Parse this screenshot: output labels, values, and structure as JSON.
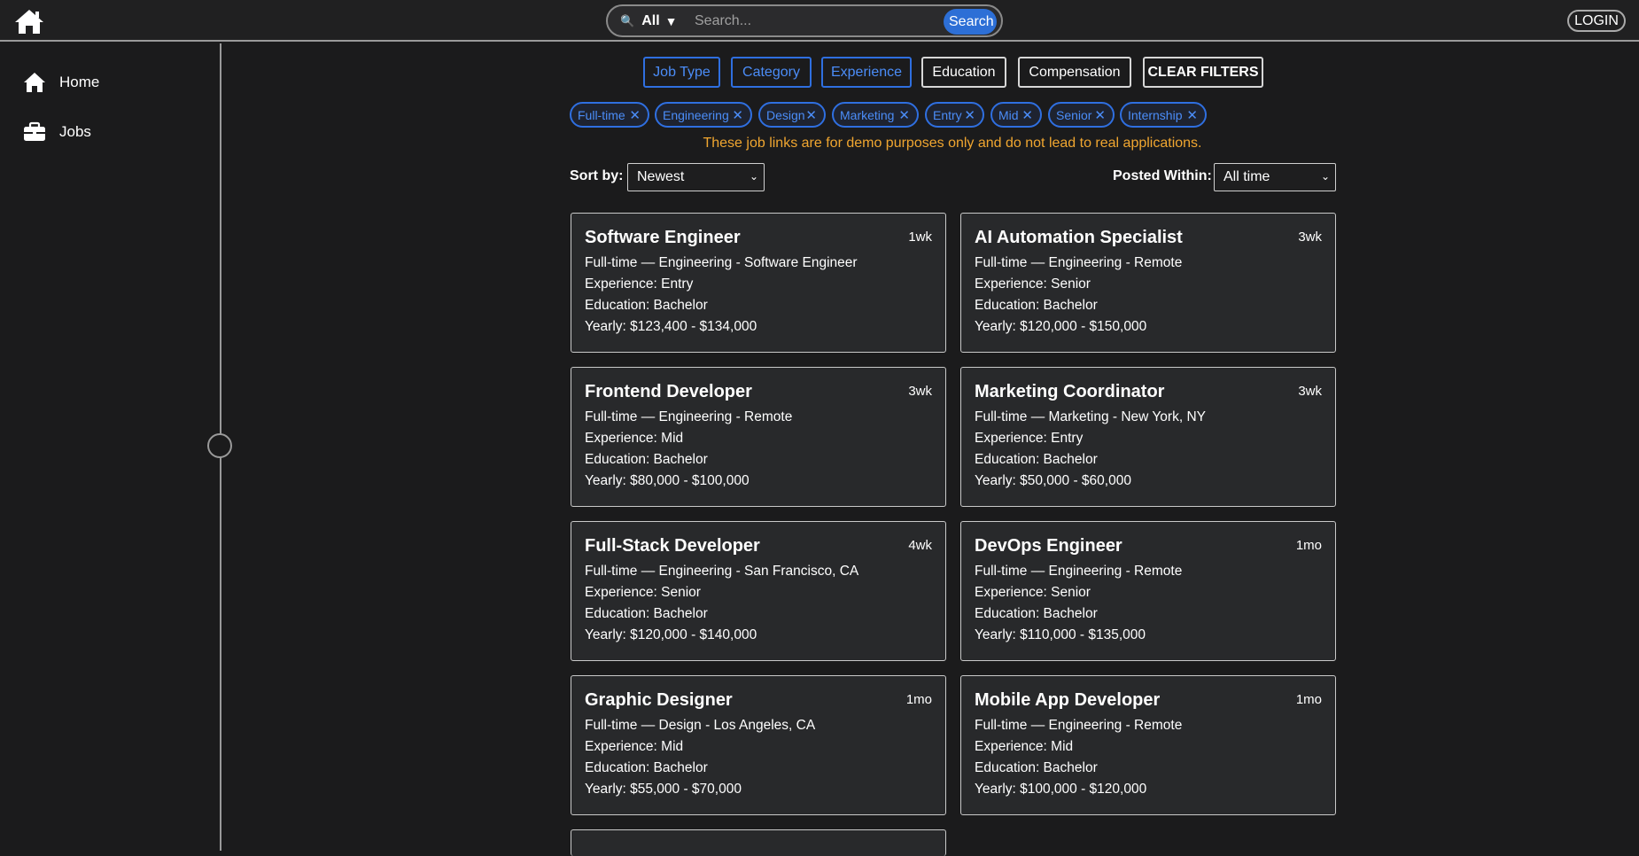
{
  "header": {
    "search_scope": "All",
    "search_placeholder": "Search...",
    "search_button": "Search",
    "login": "LOGIN"
  },
  "sidebar": {
    "items": [
      {
        "label": "Home",
        "icon": "home-icon"
      },
      {
        "label": "Jobs",
        "icon": "briefcase-icon"
      }
    ]
  },
  "filters": {
    "buttons": [
      {
        "label": "Job Type",
        "active": true
      },
      {
        "label": "Category",
        "active": true
      },
      {
        "label": "Experience",
        "active": true
      },
      {
        "label": "Education",
        "active": false
      },
      {
        "label": "Compensation",
        "active": false
      },
      {
        "label": "CLEAR FILTERS",
        "active": false
      }
    ],
    "chips": [
      "Full-time",
      "Engineering",
      "Design",
      "Marketing",
      "Entry",
      "Mid",
      "Senior",
      "Internship"
    ],
    "chip_remove_glyph": "✕"
  },
  "notice": "These job links are for demo purposes only and do not lead to real applications.",
  "sort": {
    "label": "Sort by:",
    "value": "Newest"
  },
  "posted": {
    "label": "Posted Within:",
    "value": "All time"
  },
  "jobs": [
    {
      "title": "Software Engineer",
      "age": "1wk",
      "meta": "Full-time — Engineering - Software Engineer",
      "experience": "Experience: Entry",
      "education": "Education: Bachelor",
      "pay": "Yearly: $123,400 - $134,000"
    },
    {
      "title": "AI Automation Specialist",
      "age": "3wk",
      "meta": "Full-time — Engineering - Remote",
      "experience": "Experience: Senior",
      "education": "Education: Bachelor",
      "pay": "Yearly: $120,000 - $150,000"
    },
    {
      "title": "Frontend Developer",
      "age": "3wk",
      "meta": "Full-time — Engineering - Remote",
      "experience": "Experience: Mid",
      "education": "Education: Bachelor",
      "pay": "Yearly: $80,000 - $100,000"
    },
    {
      "title": "Marketing Coordinator",
      "age": "3wk",
      "meta": "Full-time — Marketing - New York, NY",
      "experience": "Experience: Entry",
      "education": "Education: Bachelor",
      "pay": "Yearly: $50,000 - $60,000"
    },
    {
      "title": "Full-Stack Developer",
      "age": "4wk",
      "meta": "Full-time — Engineering - San Francisco, CA",
      "experience": "Experience: Senior",
      "education": "Education: Bachelor",
      "pay": "Yearly: $120,000 - $140,000"
    },
    {
      "title": "DevOps Engineer",
      "age": "1mo",
      "meta": "Full-time — Engineering - Remote",
      "experience": "Experience: Senior",
      "education": "Education: Bachelor",
      "pay": "Yearly: $110,000 - $135,000"
    },
    {
      "title": "Graphic Designer",
      "age": "1mo",
      "meta": "Full-time — Design - Los Angeles, CA",
      "experience": "Experience: Mid",
      "education": "Education: Bachelor",
      "pay": "Yearly: $55,000 - $70,000"
    },
    {
      "title": "Mobile App Developer",
      "age": "1mo",
      "meta": "Full-time — Engineering - Remote",
      "experience": "Experience: Mid",
      "education": "Education: Bachelor",
      "pay": "Yearly: $100,000 - $120,000"
    }
  ],
  "colors": {
    "background": "#1b1b1c",
    "accent": "#2f6fe0",
    "notice": "#f0a630",
    "card": "#28292b"
  }
}
